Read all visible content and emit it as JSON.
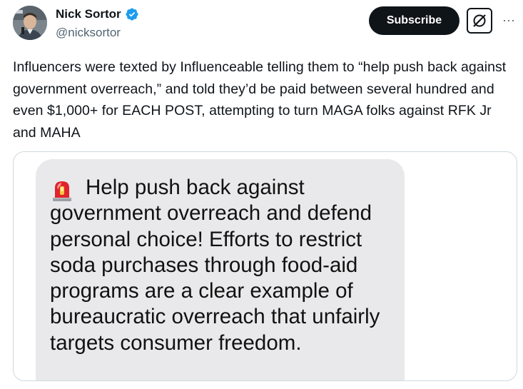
{
  "author": {
    "display_name": "Nick Sortor",
    "handle": "@nicksortor",
    "verified": true,
    "verified_badge_color": "#1d9bf0",
    "avatar_icon": "avatar-photo"
  },
  "actions": {
    "subscribe_label": "Subscribe",
    "grok_icon": "grok-icon",
    "more_icon": "more-icon",
    "more_glyph": "···"
  },
  "tweet": {
    "text": "Influencers were texted by Influenceable telling them to “help push back against government overreach,” and told they’d be paid between several hundred and even $1,000+ for EACH POST, attempting to turn MAGA folks against RFK Jr and MAHA"
  },
  "media": {
    "bubble_color": "#e9e9eb",
    "emoji_icon": "police-siren-icon",
    "message_text": "Help push back against government overreach and defend personal choice! Efforts to restrict soda purchases through food-aid programs are a clear example of bureaucratic overreach that unfairly targets consumer freedom."
  }
}
